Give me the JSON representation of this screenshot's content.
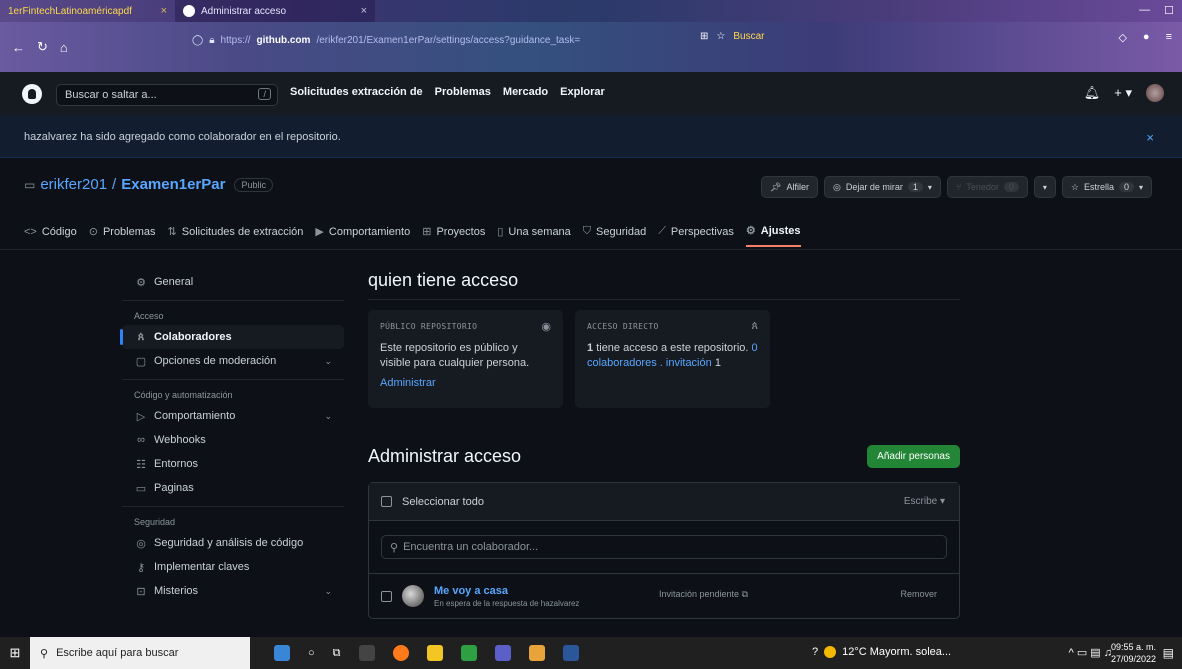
{
  "browser": {
    "tabs": [
      {
        "title": "1erFintechLatinoaméricapdf",
        "close": "×"
      },
      {
        "title": "Administrar acceso",
        "close": "×"
      }
    ],
    "url_prefix": "https://",
    "url_host": "github.com",
    "url_path": "/erikfer201/Examen1erPar/settings/access?guidance_task=",
    "search_label": "Buscar"
  },
  "gh_header": {
    "search_placeholder": "Buscar o saltar a...",
    "search_shortcut": "/",
    "nav": [
      "Solicitudes extracción de",
      "Problemas",
      "Mercado",
      "Explorar"
    ]
  },
  "flash": {
    "message": "hazalvarez ha sido agregado como colaborador en el repositorio.",
    "close": "×"
  },
  "repo": {
    "owner": "erikfer201",
    "separator": "/",
    "name": "Examen1erPar",
    "visibility": "Public",
    "actions": {
      "pin": "Alfiler",
      "watch": "Dejar de mirar",
      "watch_count": "1",
      "fork": "Tenedor",
      "fork_count": "0",
      "star": "Estrella",
      "star_count": "0"
    },
    "tabs": [
      {
        "label": "Código",
        "icon": "code-icon"
      },
      {
        "label": "Problemas",
        "icon": "issues-icon"
      },
      {
        "label": "Solicitudes de extracción",
        "icon": "pull-request-icon"
      },
      {
        "label": "Comportamiento",
        "icon": "actions-icon"
      },
      {
        "label": "Proyectos",
        "icon": "projects-icon"
      },
      {
        "label": "Una semana",
        "icon": "wiki-icon"
      },
      {
        "label": "Seguridad",
        "icon": "shield-icon"
      },
      {
        "label": "Perspectivas",
        "icon": "graph-icon"
      },
      {
        "label": "Ajustes",
        "icon": "gear-icon"
      }
    ]
  },
  "sidebar": {
    "general": "General",
    "section_access": "Acceso",
    "collaborators": "Colaboradores",
    "moderation": "Opciones de moderación",
    "section_code": "Código y automatización",
    "actions": "Comportamiento",
    "webhooks": "Webhooks",
    "environments": "Entornos",
    "pages": "Paginas",
    "section_security": "Seguridad",
    "security_analysis": "Seguridad y análisis de código",
    "deploy_keys": "Implementar claves",
    "secrets": "Misterios"
  },
  "main": {
    "who_title": "quien tiene acceso",
    "card_public": {
      "label": "PÚBLICO REPOSITORIO",
      "text": "Este repositorio es público y visible para cualquier persona.",
      "link": "Administrar"
    },
    "card_direct": {
      "label": "ACCESO DIRECTO",
      "text_count": "1",
      "text_a": "tiene acceso a este repositorio.",
      "text_link_count": "0",
      "text_link": "colaboradores . invitación",
      "text_b": "1"
    },
    "manage_title": "Administrar acceso",
    "add_people": "Añadir personas",
    "select_all": "Seleccionar todo",
    "role_filter": "Escribe ▾",
    "find_placeholder": "Encuentra un colaborador...",
    "collaborator": {
      "name": "Me voy a casa",
      "subtitle": "En espera de la respuesta de hazalvarez",
      "status": "Invitación pendiente",
      "remove": "Remover"
    }
  },
  "taskbar": {
    "search_placeholder": "Escribe aquí para buscar",
    "weather": "12°C Mayorm. solea...",
    "time": "09:55 a. m.",
    "date": "27/09/2022"
  }
}
